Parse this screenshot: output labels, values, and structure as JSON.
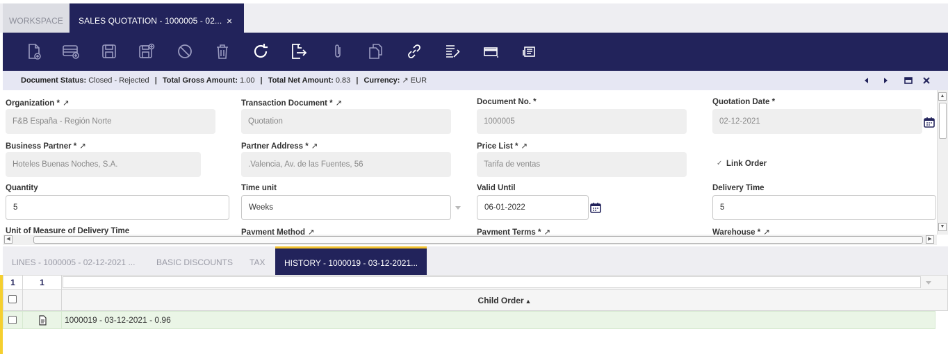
{
  "tabs": {
    "workspace": "WORKSPACE",
    "active": "SALES QUOTATION - 1000005 - 02...",
    "close": "×"
  },
  "toolbar": {
    "icons": [
      "new-document-icon",
      "new-row-icon",
      "save-icon",
      "save-and-new-icon",
      "undo-icon",
      "delete-icon",
      "refresh-icon",
      "export-icon",
      "attachment-icon",
      "clone-icon",
      "link-icon",
      "process-icon",
      "form-view-icon",
      "print-icon"
    ]
  },
  "status": {
    "doc_status_label": "Document Status:",
    "doc_status_value": "Closed - Rejected",
    "gross_label": "Total Gross Amount:",
    "gross_value": "1.00",
    "net_label": "Total Net Amount:",
    "net_value": "0.83",
    "currency_label": "Currency:",
    "currency_value": "EUR",
    "sep": "|"
  },
  "form": {
    "organization": {
      "label": "Organization *",
      "value": "F&B España - Región Norte"
    },
    "transaction_document": {
      "label": "Transaction Document *",
      "value": "Quotation"
    },
    "document_no": {
      "label": "Document No. *",
      "value": "1000005"
    },
    "quotation_date": {
      "label": "Quotation Date *",
      "value": "02-12-2021"
    },
    "business_partner": {
      "label": "Business Partner *",
      "value": "Hoteles Buenas Noches, S.A."
    },
    "partner_address": {
      "label": "Partner Address *",
      "value": ".Valencia, Av. de las Fuentes, 56"
    },
    "price_list": {
      "label": "Price List *",
      "value": "Tarifa de ventas"
    },
    "link_order": {
      "label": "Link Order",
      "checked": true
    },
    "quantity": {
      "label": "Quantity",
      "value": "5"
    },
    "time_unit": {
      "label": "Time unit",
      "value": "Weeks"
    },
    "valid_until": {
      "label": "Valid Until",
      "value": "06-01-2022"
    },
    "delivery_time": {
      "label": "Delivery Time",
      "value": "5"
    },
    "uom_delivery_time": {
      "label": "Unit of Measure of Delivery Time"
    },
    "payment_method": {
      "label": "Payment Method"
    },
    "payment_terms": {
      "label": "Payment Terms *"
    },
    "warehouse": {
      "label": "Warehouse *"
    }
  },
  "subtabs": {
    "lines": "LINES - 1000005 - 02-12-2021 ...",
    "basic_discounts": "BASIC DISCOUNTS",
    "tax": "TAX",
    "history": "HISTORY - 1000019 - 03-12-2021..."
  },
  "grid": {
    "count_selected": "1",
    "count_total": "1",
    "column_header": "Child Order",
    "sort_indicator": "▲",
    "rows": [
      {
        "child_order": "1000019 - 03-12-2021 - 0.96"
      }
    ]
  },
  "colors": {
    "navy": "#22235b",
    "accent_yellow": "#f5cf2f",
    "row_selected": "#eaf5e6"
  }
}
